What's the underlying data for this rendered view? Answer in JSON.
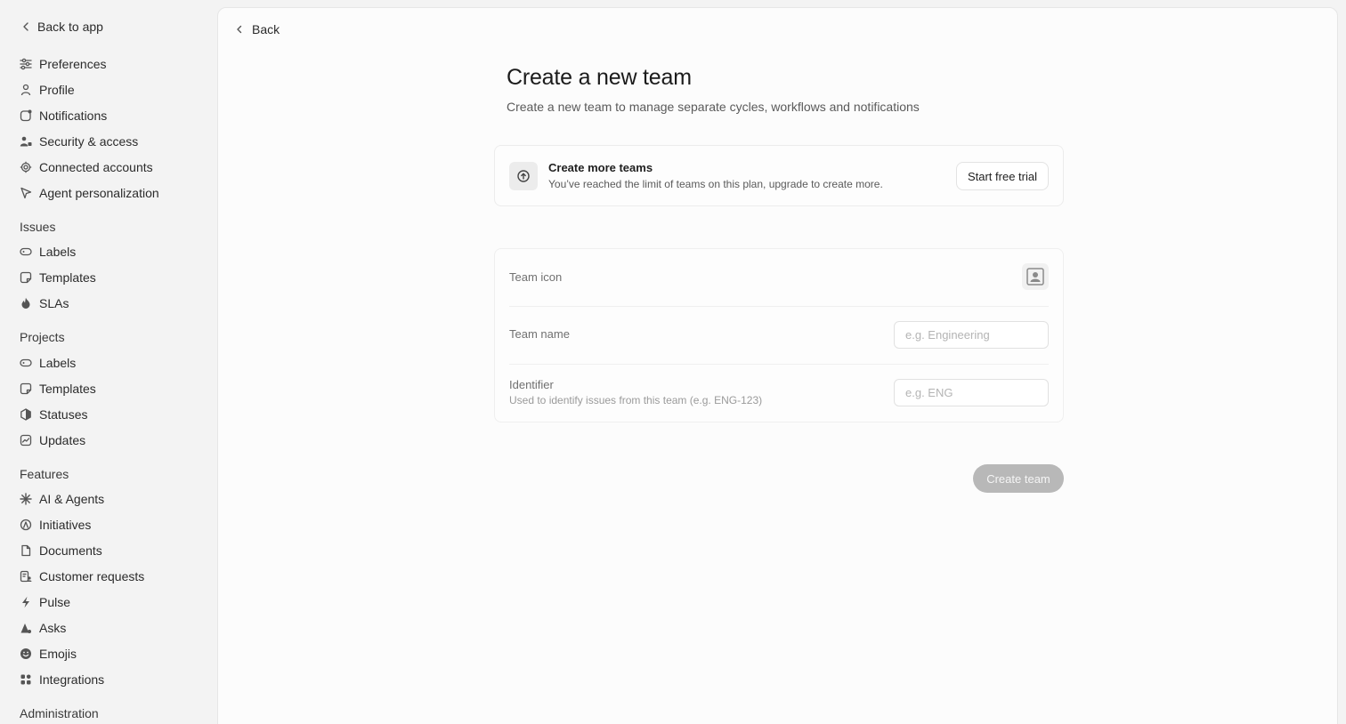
{
  "sidebar": {
    "back_label": "Back to app",
    "account_items": [
      {
        "label": "Preferences",
        "icon": "sliders-icon"
      },
      {
        "label": "Profile",
        "icon": "person-icon"
      },
      {
        "label": "Notifications",
        "icon": "notification-icon"
      },
      {
        "label": "Security & access",
        "icon": "people-lock-icon"
      },
      {
        "label": "Connected accounts",
        "icon": "gear-icon"
      },
      {
        "label": "Agent personalization",
        "icon": "cursor-icon"
      }
    ],
    "issues_title": "Issues",
    "issues_items": [
      {
        "label": "Labels",
        "icon": "tag-icon"
      },
      {
        "label": "Templates",
        "icon": "template-icon"
      },
      {
        "label": "SLAs",
        "icon": "flame-icon"
      }
    ],
    "projects_title": "Projects",
    "projects_items": [
      {
        "label": "Labels",
        "icon": "tag-icon"
      },
      {
        "label": "Templates",
        "icon": "template-icon"
      },
      {
        "label": "Statuses",
        "icon": "hexagon-icon"
      },
      {
        "label": "Updates",
        "icon": "chart-icon"
      }
    ],
    "features_title": "Features",
    "features_items": [
      {
        "label": "AI & Agents",
        "icon": "sparkle-icon"
      },
      {
        "label": "Initiatives",
        "icon": "initiative-icon"
      },
      {
        "label": "Documents",
        "icon": "document-icon"
      },
      {
        "label": "Customer requests",
        "icon": "list-user-icon"
      },
      {
        "label": "Pulse",
        "icon": "pulse-icon"
      },
      {
        "label": "Asks",
        "icon": "asks-icon"
      },
      {
        "label": "Emojis",
        "icon": "smiley-icon"
      },
      {
        "label": "Integrations",
        "icon": "grid-icon"
      }
    ],
    "administration_title": "Administration"
  },
  "main": {
    "back_label": "Back",
    "title": "Create a new team",
    "subtitle": "Create a new team to manage separate cycles, workflows and notifications",
    "upgrade": {
      "title": "Create more teams",
      "description": "You’ve reached the limit of teams on this plan, upgrade to create more.",
      "button_label": "Start free trial"
    },
    "form": {
      "team_icon_label": "Team icon",
      "team_name_label": "Team name",
      "team_name_placeholder": "e.g. Engineering",
      "team_name_value": "",
      "identifier_label": "Identifier",
      "identifier_hint": "Used to identify issues from this team (e.g. ENG-123)",
      "identifier_placeholder": "e.g. ENG",
      "identifier_value": ""
    },
    "create_button_label": "Create team"
  },
  "colors": {
    "sidebar_bg": "#f3f3f3",
    "panel_bg": "#fcfcfc",
    "disabled_button": "#b8b8b8"
  }
}
